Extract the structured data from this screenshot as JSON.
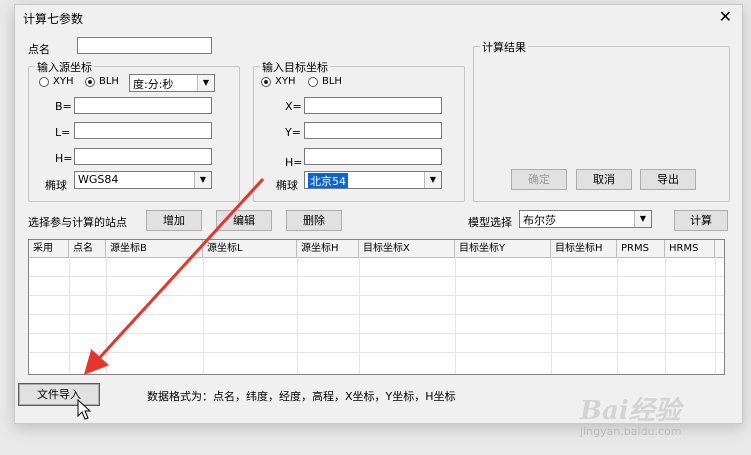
{
  "window": {
    "title": "计算七参数",
    "close_glyph": "✕"
  },
  "point_name": {
    "label": "点名",
    "value": ""
  },
  "source": {
    "group_title": "输入源坐标",
    "radio_xyh": "XYH",
    "radio_blh": "BLH",
    "format_select": "度:分:秒",
    "b_label": "B=",
    "l_label": "L=",
    "h_label": "H=",
    "ellipsoid_label": "椭球",
    "ellipsoid_value": "WGS84"
  },
  "target": {
    "group_title": "输入目标坐标",
    "radio_xyh": "XYH",
    "radio_blh": "BLH",
    "x_label": "X=",
    "y_label": "Y=",
    "h_label": "H=",
    "ellipsoid_label": "椭球",
    "ellipsoid_value": "北京54"
  },
  "result": {
    "group_title": "计算结果",
    "ok_button": "确定",
    "cancel_button": "取消",
    "export_button": "导出"
  },
  "stations": {
    "label": "选择参与计算的站点",
    "add_button": "增加",
    "edit_button": "编辑",
    "delete_button": "删除",
    "model_label": "模型选择",
    "model_value": "布尔莎",
    "calc_button": "计算"
  },
  "table": {
    "columns": [
      "采用",
      "点名",
      "源坐标B",
      "源坐标L",
      "源坐标H",
      "目标坐标X",
      "目标坐标Y",
      "目标坐标H",
      "PRMS",
      "HRMS"
    ]
  },
  "footer": {
    "import_button": "文件导入",
    "format_note": "数据格式为：点名，纬度，经度，高程，X坐标，Y坐标，H坐标"
  },
  "watermark": {
    "logo": "Bai经验",
    "url": "jingyan.baidu.com"
  },
  "colors": {
    "annotation_arrow": "#e8352b",
    "selection": "#0a64d6"
  }
}
